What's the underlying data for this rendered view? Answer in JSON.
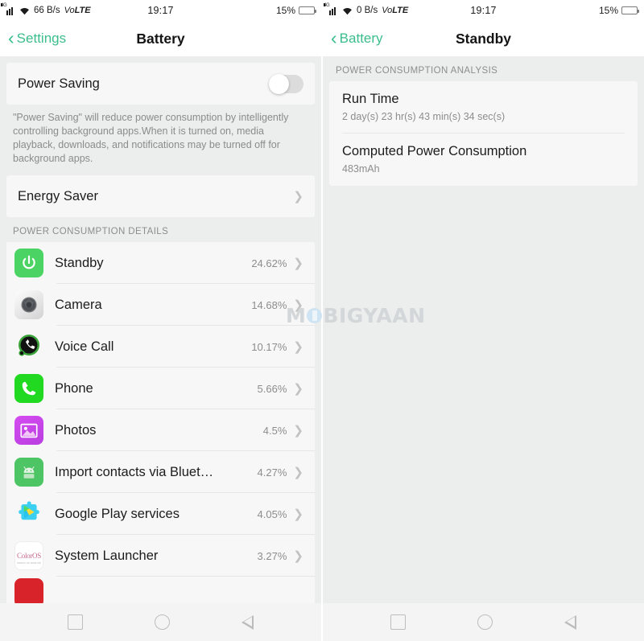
{
  "left": {
    "statusbar": {
      "network_type": "4G",
      "data_speed": "66 B/s",
      "volte_pre": "Vo",
      "volte_post": "LTE",
      "time": "19:17",
      "battery_percent": "15%"
    },
    "header": {
      "back_label": "Settings",
      "title": "Battery"
    },
    "power_saving": {
      "label": "Power Saving",
      "toggle_state": "off",
      "description": "\"Power Saving\" will reduce power consumption by intelligently controlling background apps.When it is turned on, media playback, downloads, and notifications may be turned off for background apps."
    },
    "energy_saver": {
      "label": "Energy Saver"
    },
    "section_header": "POWER CONSUMPTION DETAILS",
    "apps": [
      {
        "name": "Standby",
        "value": "24.62%",
        "icon": "power-icon"
      },
      {
        "name": "Camera",
        "value": "14.68%",
        "icon": "camera-icon"
      },
      {
        "name": "Voice Call",
        "value": "10.17%",
        "icon": "voice-call-icon"
      },
      {
        "name": "Phone",
        "value": "5.66%",
        "icon": "phone-icon"
      },
      {
        "name": "Photos",
        "value": "4.5%",
        "icon": "photos-icon"
      },
      {
        "name": "Import contacts via Bluet…",
        "value": "4.27%",
        "icon": "android-icon"
      },
      {
        "name": "Google Play services",
        "value": "4.05%",
        "icon": "google-play-icon"
      },
      {
        "name": "System Launcher",
        "value": "3.27%",
        "icon": "coloros-icon"
      }
    ],
    "coloros_logo": {
      "text": "ColorOS",
      "subtitle": "based on android"
    }
  },
  "right": {
    "statusbar": {
      "network_type": "4G",
      "data_speed": "0 B/s",
      "volte_pre": "Vo",
      "volte_post": "LTE",
      "time": "19:17",
      "battery_percent": "15%"
    },
    "header": {
      "back_label": "Battery",
      "title": "Standby"
    },
    "section_header": "POWER CONSUMPTION ANALYSIS",
    "details": [
      {
        "title": "Run Time",
        "value": "2 day(s) 23 hr(s) 43 min(s) 34 sec(s)"
      },
      {
        "title": "Computed Power Consumption",
        "value": "483mAh"
      }
    ]
  },
  "watermark": {
    "pre": "M",
    "post": "BIGYAAN"
  },
  "colors": {
    "accent_green": "#3bbd8d",
    "battery_red": "#e8221d",
    "standby_green": "#4bd363",
    "phone_green": "#22d922",
    "photos_purple": "#c73fe8",
    "background": "#eceded",
    "card": "#f7f7f7"
  }
}
